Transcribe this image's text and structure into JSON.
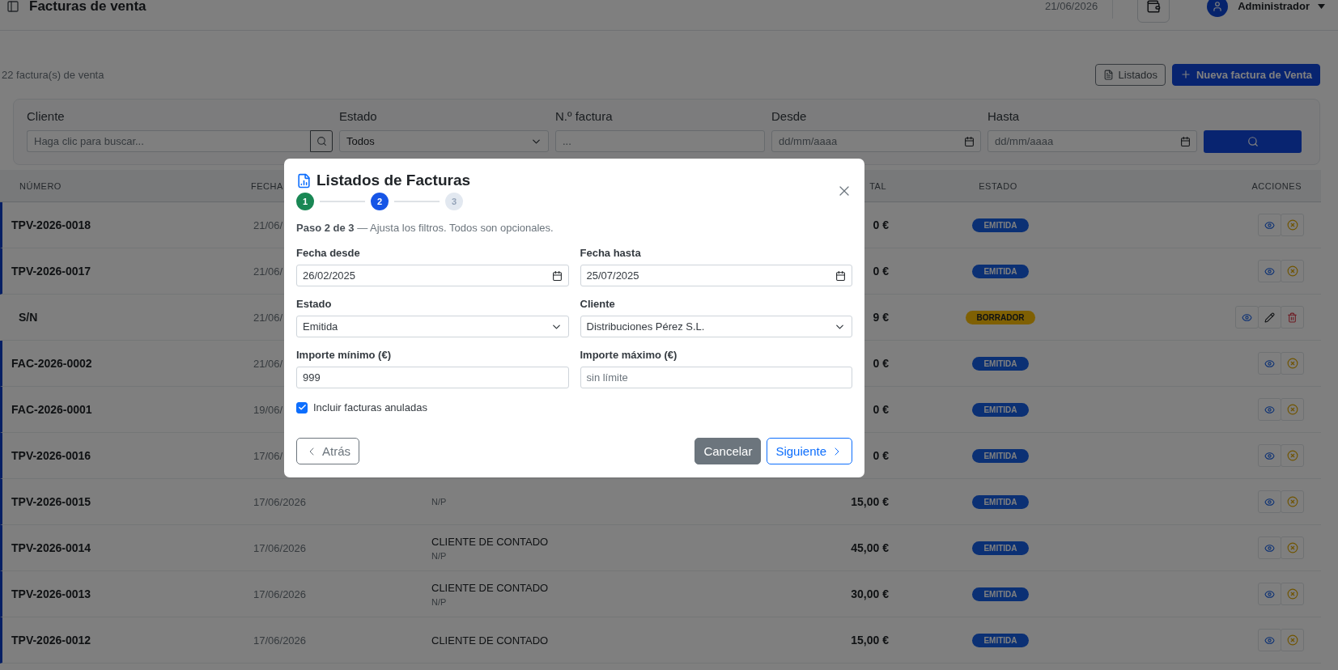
{
  "header": {
    "title": "Facturas de venta",
    "date": "21/06/2026",
    "user": "Administrador"
  },
  "toolbar": {
    "count": "22 factura(s) de venta",
    "buttons": [
      {
        "label": "Listados",
        "kind": "outline"
      },
      {
        "label": "Nueva factura de Venta",
        "kind": "primary"
      }
    ]
  },
  "filters": {
    "fields": [
      {
        "label": "Cliente",
        "kind": "search",
        "placeholder": "Haga clic para buscar..."
      },
      {
        "label": "Estado",
        "kind": "select",
        "value": "Todos"
      },
      {
        "label": "N.º factura",
        "kind": "text",
        "placeholder": "..."
      },
      {
        "label": "Desde",
        "kind": "date",
        "placeholder": "dd/mm/aaaa"
      },
      {
        "label": "Hasta",
        "kind": "date",
        "placeholder": "dd/mm/aaaa"
      }
    ]
  },
  "table": {
    "columns": {
      "number": "NÚMERO",
      "date": "FECHA",
      "total": "TAL",
      "status": "ESTADO",
      "actions": "ACCIONES"
    },
    "rows": [
      {
        "number": "TPV-2026-0018",
        "date": "21/06/",
        "total": "0 €",
        "status": {
          "label": "EMITIDA",
          "kind": "emitida"
        }
      },
      {
        "number": "TPV-2026-0017",
        "date": "21/06/",
        "total": "0 €",
        "status": {
          "label": "EMITIDA",
          "kind": "emitida"
        }
      },
      {
        "number": "S/N",
        "date": "21/06/",
        "total": "9 €",
        "status": {
          "label": "BORRADOR",
          "kind": "borrador"
        }
      },
      {
        "number": "FAC-2026-0002",
        "date": "21/06/",
        "total": "0 €",
        "status": {
          "label": "EMITIDA",
          "kind": "emitida"
        }
      },
      {
        "number": "FAC-2026-0001",
        "date": "19/06/",
        "total": "0 €",
        "status": {
          "label": "EMITIDA",
          "kind": "emitida"
        }
      },
      {
        "number": "TPV-2026-0016",
        "date": "17/06/",
        "total": "0 €",
        "status": {
          "label": "EMITIDA",
          "kind": "emitida"
        }
      },
      {
        "number": "TPV-2026-0015",
        "date": "17/06/2026",
        "client": {
          "sub": "N/P"
        },
        "total": "15,00 €",
        "status": {
          "label": "EMITIDA",
          "kind": "emitida"
        }
      },
      {
        "number": "TPV-2026-0014",
        "date": "17/06/2026",
        "client": {
          "name": "CLIENTE DE CONTADO",
          "sub": "N/P"
        },
        "total": "45,00 €",
        "status": {
          "label": "EMITIDA",
          "kind": "emitida"
        }
      },
      {
        "number": "TPV-2026-0013",
        "date": "17/06/2026",
        "client": {
          "name": "CLIENTE DE CONTADO",
          "sub": "N/P"
        },
        "total": "30,00 €",
        "status": {
          "label": "EMITIDA",
          "kind": "emitida"
        }
      },
      {
        "number": "TPV-2026-0012",
        "date": "17/06/2026",
        "client": {
          "name": "CLIENTE DE CONTADO"
        },
        "total": "15,00 €",
        "status": {
          "label": "EMITIDA",
          "kind": "emitida"
        }
      }
    ]
  },
  "modal": {
    "title": "Listados de Facturas",
    "steps": [
      {
        "label": "1",
        "done": true,
        "selected": false
      },
      {
        "label": "2",
        "done": false,
        "selected": true
      },
      {
        "label": "3",
        "done": false,
        "selected": false
      }
    ],
    "description": "**Paso 2 de 3** — Ajusta los filtros. Todos son opcionales.",
    "fields": [
      {
        "label": "Fecha desde",
        "kind": "date",
        "value": "26/02/2025"
      },
      {
        "label": "Fecha hasta",
        "kind": "date",
        "value": "25/07/2025"
      },
      {
        "label": "Estado",
        "kind": "select",
        "value": "Emitida"
      },
      {
        "label": "Cliente",
        "kind": "select",
        "value": "Distribuciones Pérez S.L."
      },
      {
        "label": "Importe mínimo (€)",
        "kind": "text",
        "value": "999"
      },
      {
        "label": "Importe máximo (€)",
        "kind": "text",
        "placeholder": "sin límite"
      }
    ],
    "checkbox": {
      "label": "Incluir facturas anuladas",
      "checked": true
    },
    "buttons": {
      "back": "Atrás",
      "cancel": "Cancelar",
      "next": "Siguiente"
    }
  }
}
